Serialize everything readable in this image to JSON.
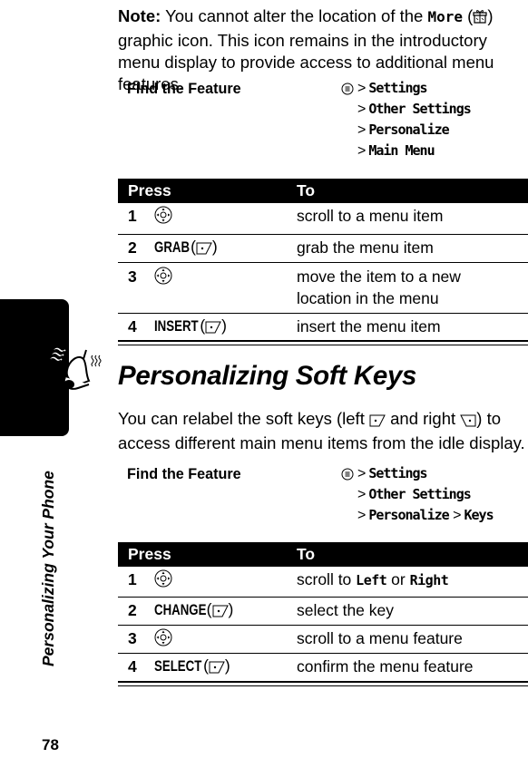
{
  "note": {
    "label": "Note:",
    "text_before": "You cannot alter the location of the",
    "more_label": "More",
    "more_icon": "more-gift-icon",
    "text_after": "graphic icon. This icon remains in the introductory menu display to provide access to additional menu features."
  },
  "section1": {
    "find_label": "Find the Feature",
    "menu_icon": "menu-key-icon",
    "path": [
      "Settings",
      "Other Settings",
      "Personalize",
      "Main Menu"
    ],
    "table": {
      "headers": [
        "Press",
        "To"
      ],
      "rows": [
        {
          "num": "1",
          "press_icon": "nav-key-icon",
          "press_label": "",
          "to": "scroll to a menu item"
        },
        {
          "num": "2",
          "press_icon": "left-soft-key-icon",
          "press_label": "GRAB",
          "to": "grab the menu item"
        },
        {
          "num": "3",
          "press_icon": "nav-key-icon",
          "press_label": "",
          "to": "move the item to a new location in the menu"
        },
        {
          "num": "4",
          "press_icon": "left-soft-key-icon",
          "press_label": "INSERT",
          "to": "insert the menu item"
        }
      ]
    }
  },
  "section2": {
    "title": "Personalizing Soft Keys",
    "intro_part1": "You can relabel the soft keys (left",
    "intro_part2": "and right",
    "intro_part3": ") to access different main menu items from the idle display.",
    "find_label": "Find the Feature",
    "menu_icon": "menu-key-icon",
    "path": [
      "Settings",
      "Other Settings",
      "Personalize",
      "Keys"
    ],
    "table": {
      "headers": [
        "Press",
        "To"
      ],
      "rows": [
        {
          "num": "1",
          "press_icon": "nav-key-icon",
          "press_label": "",
          "to_prefix": "scroll to",
          "to_key1": "Left",
          "to_mid": "or",
          "to_key2": "Right"
        },
        {
          "num": "2",
          "press_icon": "left-soft-key-icon",
          "press_label": "CHANGE",
          "to": "select the key"
        },
        {
          "num": "3",
          "press_icon": "nav-key-icon",
          "press_label": "",
          "to": "scroll to a menu feature"
        },
        {
          "num": "4",
          "press_icon": "left-soft-key-icon",
          "press_label": "SELECT",
          "to": "confirm the menu feature"
        }
      ]
    }
  },
  "sidebar": {
    "chapter_label": "Personalizing Your Phone",
    "chapter_icon": "ringing-bell-icon",
    "page_number": "78"
  }
}
